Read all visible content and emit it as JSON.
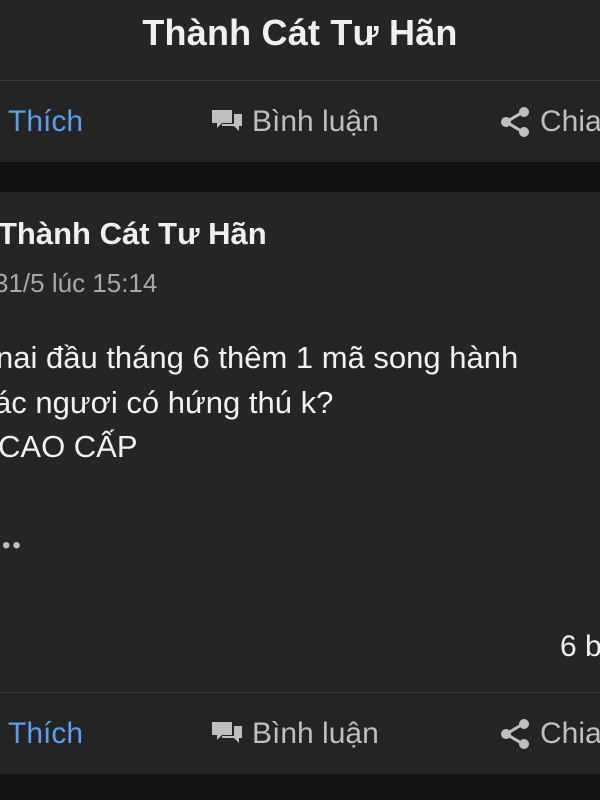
{
  "header": {
    "title": "Thành Cát Tư Hãn"
  },
  "actions_top": {
    "like_label": "Thích",
    "comment_label": "Bình luận",
    "share_label": "Chia"
  },
  "post": {
    "author": "Thành Cát Tư Hãn",
    "timestamp": "31/5 lúc 15:14",
    "body": [
      "nai đầu tháng 6 thêm 1 mã song hành",
      "ác ngươi có hứng thú k?",
      "CAO CẤP"
    ],
    "more_indicator": "••",
    "reaction_count_fragment": "6 b"
  },
  "actions_bottom": {
    "like_label": "Thích",
    "comment_label": "Bình luận",
    "share_label": "Chia"
  },
  "colors": {
    "accent": "#5aa0e8",
    "background": "#161616",
    "panel": "#252525",
    "text": "#f2f2f2",
    "muted_text": "#a8a8a8"
  },
  "icons": {
    "like": "thumbs-up-icon",
    "comment": "comment-bubbles-icon",
    "share": "share-nodes-icon"
  }
}
